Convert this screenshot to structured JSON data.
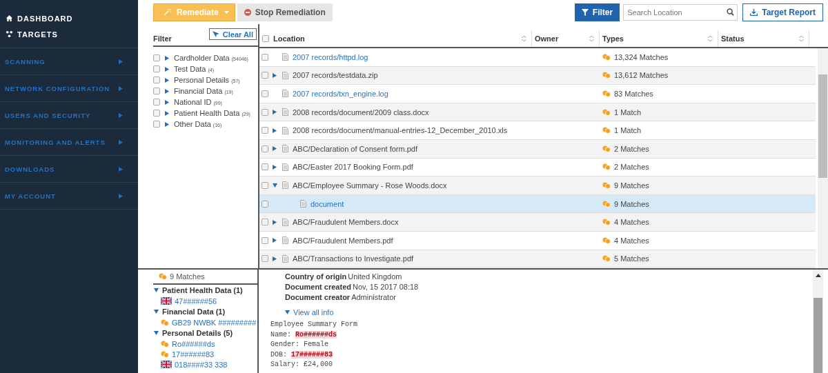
{
  "sidebar": {
    "top_items": [
      {
        "label": "DASHBOARD"
      },
      {
        "label": "TARGETS"
      }
    ],
    "sections": [
      {
        "label": "SCANNING"
      },
      {
        "label": "NETWORK CONFIGURATION"
      },
      {
        "label": "USERS AND SECURITY"
      },
      {
        "label": "MONITORING AND ALERTS"
      },
      {
        "label": "DOWNLOADS"
      },
      {
        "label": "MY ACCOUNT"
      }
    ]
  },
  "toolbar": {
    "remediate": "Remediate",
    "stop": "Stop Remediation",
    "filter": "Filter",
    "search": {
      "placeholder": "Search Location"
    },
    "report": "Target Report"
  },
  "filter_panel": {
    "title": "Filter",
    "clear": "Clear All",
    "items": [
      {
        "label": "Cardholder Data",
        "count": "(54046)",
        "checked": false
      },
      {
        "label": "Test Data",
        "count": "(4)",
        "checked": false
      },
      {
        "label": "Personal Details",
        "count": "(57)",
        "checked": false
      },
      {
        "label": "Financial Data",
        "count": "(19)",
        "checked": false
      },
      {
        "label": "National ID",
        "count": "(99)",
        "checked": false
      },
      {
        "label": "Patient Health Data",
        "count": "(29)",
        "checked": false
      },
      {
        "label": "Other Data",
        "count": "(16)",
        "checked": false
      }
    ]
  },
  "table": {
    "select_all_checked": false,
    "columns": [
      "Location",
      "Owner",
      "Types",
      "Status"
    ],
    "rows": [
      {
        "kind": "file",
        "location": "2007 records/httpd.log",
        "link": true,
        "selected": false,
        "checked": false,
        "types": "13,324 Matches"
      },
      {
        "kind": "folder",
        "location": "2007 records/testdata.zip",
        "link": false,
        "expanded": false,
        "selected": false,
        "checked": false,
        "types": "13,612 Matches"
      },
      {
        "kind": "file",
        "location": "2007 records/txn_engine.log",
        "link": true,
        "selected": false,
        "checked": false,
        "types": "83 Matches"
      },
      {
        "kind": "folder",
        "location": "2008 records/document/2009 class.docx",
        "link": false,
        "expanded": false,
        "selected": false,
        "checked": false,
        "types": "1 Match"
      },
      {
        "kind": "folder",
        "location": "2008 records/document/manual-entries-12_December_2010.xls",
        "link": false,
        "expanded": false,
        "selected": false,
        "checked": false,
        "types": "1 Match"
      },
      {
        "kind": "folder",
        "location": "ABC/Declaration of Consent form.pdf",
        "link": false,
        "expanded": false,
        "selected": false,
        "checked": false,
        "types": "2 Matches"
      },
      {
        "kind": "folder",
        "location": "ABC/Easter 2017 Booking Form.pdf",
        "link": false,
        "expanded": false,
        "selected": false,
        "checked": false,
        "types": "2 Matches"
      },
      {
        "kind": "folder",
        "location": "ABC/Employee Summary - Rose Woods.docx",
        "link": false,
        "expanded": true,
        "selected": false,
        "checked": false,
        "types": "9 Matches",
        "children": [
          {
            "kind": "file",
            "location": "document",
            "link": true,
            "selected": true,
            "checked": false,
            "types": "9 Matches"
          }
        ]
      },
      {
        "kind": "folder",
        "location": "ABC/Fraudulent Members.docx",
        "link": false,
        "expanded": false,
        "selected": false,
        "checked": false,
        "types": "4 Matches"
      },
      {
        "kind": "folder",
        "location": "ABC/Fraudulent Members.pdf",
        "link": false,
        "expanded": false,
        "selected": false,
        "checked": false,
        "types": "4 Matches"
      },
      {
        "kind": "folder",
        "location": "ABC/Transactions to Investigate.pdf",
        "link": false,
        "expanded": false,
        "selected": false,
        "checked": false,
        "types": "5 Matches"
      }
    ]
  },
  "matches": {
    "total": "9 Matches",
    "groups": [
      {
        "label": "Patient Health Data (1)",
        "expanded": true,
        "items": [
          {
            "kind": "flag",
            "text": "47######56"
          }
        ]
      },
      {
        "label": "Financial Data (1)",
        "expanded": true,
        "items": [
          {
            "kind": "match",
            "text": "GB29 NWBK #########"
          }
        ]
      },
      {
        "label": "Personal Details (5)",
        "expanded": true,
        "items": [
          {
            "kind": "match",
            "text": "Ro######ds"
          },
          {
            "kind": "match",
            "text": "17######83"
          },
          {
            "kind": "flag",
            "text": "018####33 338"
          }
        ]
      }
    ]
  },
  "details": {
    "meta": [
      {
        "label": "Country of origin",
        "value": "United Kingdom"
      },
      {
        "label": "Document created",
        "value": "Nov, 15 2017 08:18"
      },
      {
        "label": "Document creator",
        "value": "Administrator"
      }
    ],
    "view_all": "View all info",
    "lines": [
      {
        "label": "Employee Summary Form"
      },
      {
        "label": "Name: ",
        "value": "Ro######ds",
        "redacted": true
      },
      {
        "label": "Gender: ",
        "value": "Female",
        "redacted": false
      },
      {
        "label": "DOB: ",
        "value": "17######83",
        "redacted": true
      },
      {
        "label": "Salary: ",
        "value": "£24,000",
        "redacted": false
      }
    ]
  }
}
